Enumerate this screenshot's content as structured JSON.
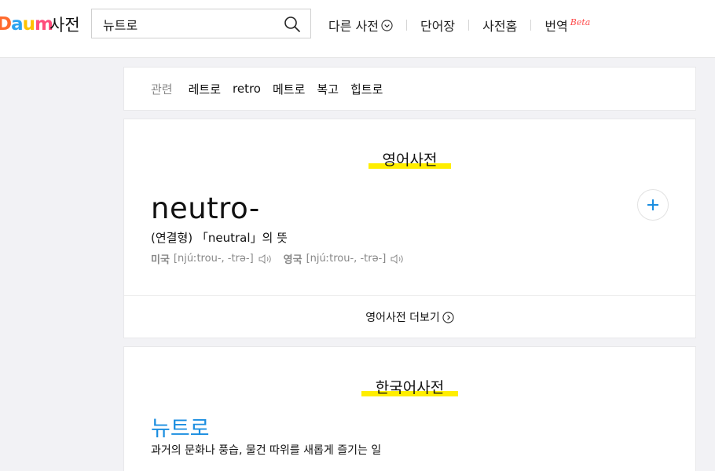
{
  "header": {
    "logo": [
      "D",
      "a",
      "u",
      "m"
    ],
    "service_name": "사전",
    "search": {
      "value": "뉴트로",
      "placeholder": ""
    },
    "nav": {
      "more_dict": "다른 사전",
      "wordbook": "단어장",
      "dict_home": "사전홈",
      "translate": "번역",
      "beta": "Beta"
    }
  },
  "related": {
    "label": "관련",
    "words": [
      "레트로",
      "retro",
      "메트로",
      "복고",
      "힙트로"
    ]
  },
  "english_dict": {
    "title": "영어사전",
    "headword": "neutro-",
    "meaning": "(연결형) 「neutral」의 뜻",
    "pron_us_label": "미국",
    "pron_us": "[njúːtrou-, -trə-]",
    "pron_uk_label": "영국",
    "pron_uk": "[njúːtrou-, -trə-]",
    "more_label": "영어사전 더보기"
  },
  "korean_dict": {
    "title": "한국어사전",
    "headword": "뉴트로",
    "meaning": "과거의 문화나 풍습, 물건 따위를 새롭게 즐기는 일"
  },
  "colors": {
    "accent_blue": "#1b8ee0",
    "highlight_yellow": "#ffee00",
    "beta_red": "#ff4d4d"
  }
}
